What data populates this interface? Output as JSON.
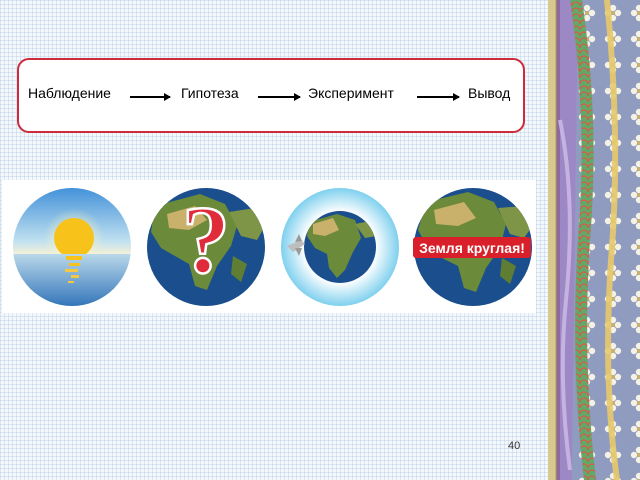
{
  "flow": {
    "steps": [
      "Наблюдение",
      "Гипотеза",
      "Эксперимент",
      "Вывод"
    ]
  },
  "images": {
    "question_mark": "?",
    "banner_text": "Земля круглая!"
  },
  "page_number": "40",
  "colors": {
    "box_border": "#cc2b3b",
    "ocean": "#1a4e8c",
    "land": "#6b8a3a",
    "sky_top": "#3f8fd8",
    "sun": "#f7c21a",
    "banner_red": "#d9202a"
  }
}
